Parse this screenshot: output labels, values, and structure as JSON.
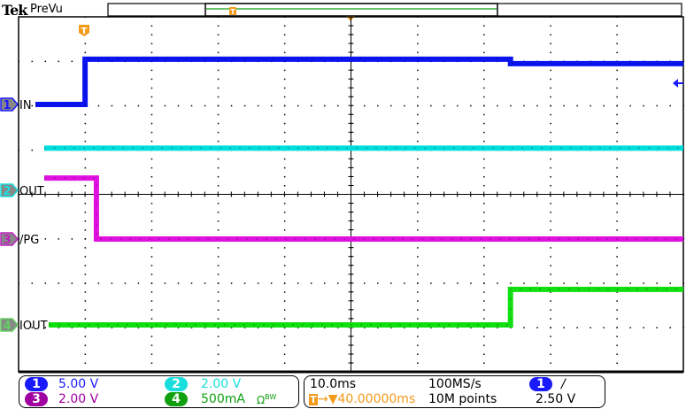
{
  "header": {
    "brand": "Tek",
    "mode": "PreVu"
  },
  "chart_data": {
    "type": "line",
    "x_unit": "ms",
    "xlim": [
      -10,
      90
    ],
    "grid": true,
    "divisions": {
      "horizontal": 10,
      "vertical": 8
    },
    "series": [
      {
        "name": "IN",
        "channel": "1",
        "color": "#0a14f0",
        "unit": "V",
        "scale_per_div": 5.0,
        "points": [
          [
            -10,
            0
          ],
          [
            0,
            0
          ],
          [
            0,
            5.1
          ],
          [
            64,
            5.1
          ],
          [
            64,
            4.6
          ],
          [
            90,
            4.6
          ]
        ]
      },
      {
        "name": "OUT",
        "channel": "2",
        "color": "#00dede",
        "unit": "V",
        "scale_per_div": 2.0,
        "points": [
          [
            -10,
            1.9
          ],
          [
            90,
            1.9
          ]
        ]
      },
      {
        "name": "/PG",
        "channel": "3",
        "color": "#e010e0",
        "unit": "V",
        "scale_per_div": 2.0,
        "points": [
          [
            -10,
            2.75
          ],
          [
            1.7,
            2.75
          ],
          [
            1.7,
            0
          ],
          [
            90,
            0
          ]
        ]
      },
      {
        "name": "IOUT",
        "channel": "4",
        "color": "#10e010",
        "unit": "mA",
        "scale_per_div": 500,
        "points": [
          [
            -10,
            0
          ],
          [
            64,
            0
          ],
          [
            64,
            400
          ],
          [
            90,
            400
          ]
        ]
      }
    ]
  },
  "trigger_marker": "T",
  "channels": {
    "ch1": {
      "num": "1",
      "scale": "5.00 V",
      "color": "#1a1aff"
    },
    "ch2": {
      "num": "2",
      "scale": "2.00 V",
      "color": "#19dede"
    },
    "ch3": {
      "num": "3",
      "scale": "2.00 V",
      "color": "#a000a0"
    },
    "ch4": {
      "num": "4",
      "scale": "500mA",
      "color": "#10a010",
      "bw_icon": "Ω",
      "bw_label": "BW"
    }
  },
  "horizontal": {
    "time_per_div": "10.0ms",
    "delay": "40.00000ms",
    "sample_rate": "100MS/s",
    "record_length": "10M points"
  },
  "trigger": {
    "source": "1",
    "slope": "/",
    "level": "2.50 V"
  }
}
